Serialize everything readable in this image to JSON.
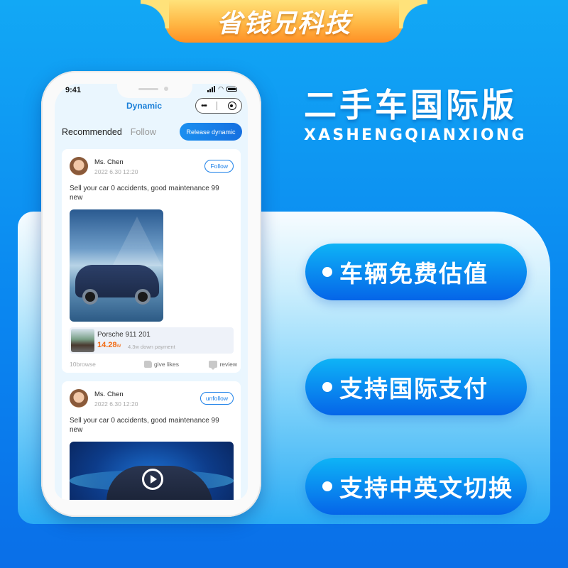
{
  "banner": {
    "brand": "省钱兄科技",
    "headline": "二手车国际版",
    "subline": "XASHENGQIANXIONG"
  },
  "features": [
    {
      "label": "车辆免费估值"
    },
    {
      "label": "支持国际支付"
    },
    {
      "label": "支持中英文切换"
    }
  ],
  "phone": {
    "status": {
      "time": "9:41"
    },
    "nav": {
      "title": "Dynamic",
      "more_icon": "•••",
      "target_icon": "record-icon"
    },
    "tabs": [
      {
        "label": "Recommended",
        "active": true
      },
      {
        "label": "Follow",
        "active": false
      }
    ],
    "release_button": "Release dynamic",
    "posts": [
      {
        "user": "Ms. Chen",
        "time": "2022 6.30 12:20",
        "follow_label": "Follow",
        "text": "Sell your car 0 accidents, good maintenance 99 new",
        "listing": {
          "name": "Porsche 911 201",
          "price": "14.28",
          "price_unit": "w",
          "down_payment": "4.3w down payment"
        },
        "stats": {
          "browse": "10browse",
          "likes": "give likes",
          "review": "review"
        }
      },
      {
        "user": "Ms. Chen",
        "time": "2022 6.30 12:20",
        "follow_label": "unfollow",
        "text": "Sell your car 0 accidents, good maintenance 99 new"
      }
    ]
  },
  "colors": {
    "accent": "#1a7fe8",
    "price": "#f26a12",
    "banner_orange": "#ff9025"
  }
}
